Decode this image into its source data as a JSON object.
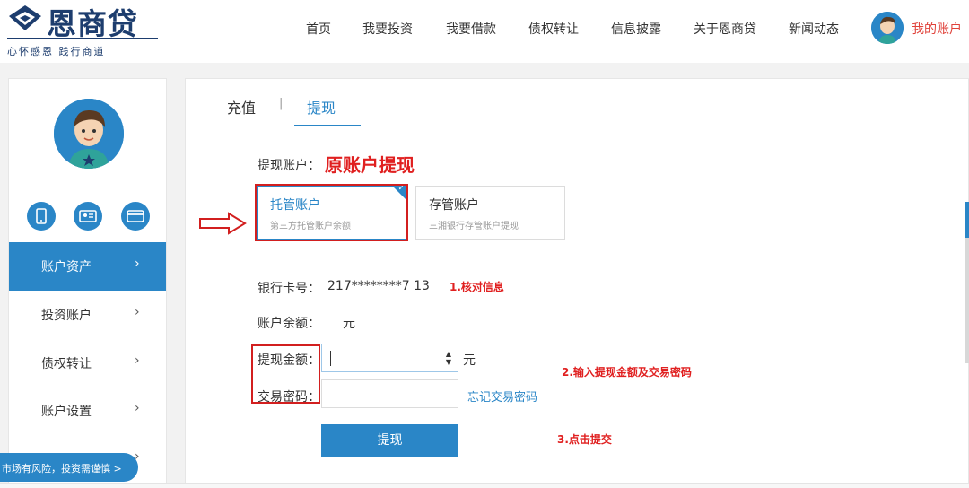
{
  "brand": {
    "name": "恩商贷",
    "slogan": "心怀感恩  践行商道",
    "color": "#1d3d6e",
    "accent": "#2a86c7",
    "alert": "#e02020"
  },
  "nav": {
    "items": [
      "首页",
      "我要投资",
      "我要借款",
      "债权转让",
      "信息披露",
      "关于恩商贷",
      "新闻动态"
    ],
    "my_account": "我的账户"
  },
  "sidebar": {
    "icons": [
      "phone-icon",
      "id-card-icon",
      "bank-card-icon"
    ],
    "menu": [
      {
        "label": "账户资产",
        "active": true
      },
      {
        "label": "投资账户",
        "active": false
      },
      {
        "label": "债权转让",
        "active": false
      },
      {
        "label": "账户设置",
        "active": false
      }
    ],
    "chevron": "›"
  },
  "risk_notice": "市场有风险，投资需谨慎  >",
  "tabs": {
    "recharge": "充值",
    "separator": "|",
    "withdraw": "提现"
  },
  "form": {
    "account_label": "提现账户：",
    "account_highlight": "原账户提现",
    "cards": [
      {
        "title": "托管账户",
        "subtitle": "第三方托管账户余额",
        "selected": true
      },
      {
        "title": "存管账户",
        "subtitle": "三湘银行存管账户提现",
        "selected": false
      }
    ],
    "bank_card_label": "银行卡号：",
    "bank_card_value": "217********7  13",
    "balance_label": "账户余额：",
    "balance_unit": "元",
    "amount_label": "提现金额：",
    "amount_value": "",
    "amount_unit": "元",
    "password_label": "交易密码：",
    "password_value": "",
    "forgot_password": "忘记交易密码",
    "submit": "提现"
  },
  "annotations": {
    "step1": "1.核对信息",
    "step2": "2.输入提现金额及交易密码",
    "step3": "3.点击提交"
  }
}
